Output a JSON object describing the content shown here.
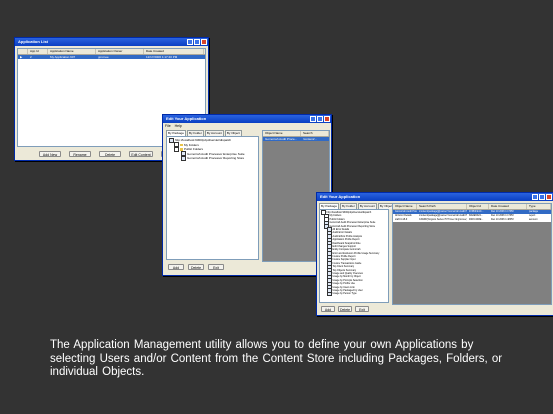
{
  "windows": {
    "app_list": {
      "title": "Application List",
      "columns": [
        "App Id",
        "Application Name",
        "Application Owner",
        "Date Created"
      ],
      "rows": [
        [
          "2",
          "My Application 907",
          "gmcnee",
          "12/17/2006 1:17:40 PM"
        ]
      ],
      "buttons": [
        "Add New",
        "Rename",
        "Delete",
        "Edit Content",
        "Close"
      ]
    },
    "edit_app_1": {
      "title": "Edit Your Application",
      "menu": [
        "File",
        "Help"
      ],
      "tabs": [
        "By Package",
        "By Folder",
        "By Account",
        "By Object"
      ],
      "tree": [
        {
          "label": "http://localhost:9300/p2pd/servlet/dispatch",
          "level": 0,
          "type": "check"
        },
        {
          "label": "My Folders",
          "level": 1,
          "type": "folder"
        },
        {
          "label": "Public Folders",
          "level": 1,
          "type": "folder"
        },
        {
          "label": "Gomorrah Audit Processor Enterprise Suite",
          "level": 2,
          "type": "check"
        },
        {
          "label": "Gomorrah Audit Processor Reporting Store",
          "level": 2,
          "type": "check"
        }
      ],
      "right_columns": [
        "Object Name",
        "Search"
      ],
      "right_rows": [
        [
          "Gomorrah Audit Proce...",
          "/content/..."
        ]
      ],
      "buttons": [
        "Add",
        "Delete",
        "Exit"
      ]
    },
    "edit_app_2": {
      "title": "Edit Your Application",
      "tabs": [
        "By Package",
        "By Folder",
        "By Account",
        "By Object"
      ],
      "tree": [
        "http://localhost:9300/p2pd/servlet/dispatch",
        "My Folders",
        "Public Folders",
        "Gomorrah Audit Processor Enterprise Suite",
        "Gomorrah Audit Processor Reporting Store",
        "All Error Details",
        "Audit Error Details",
        "Audit Ethics Profile Analysis",
        "Application Profile Report",
        "Dashboard Snapshot Rule",
        "Edit Changes Support",
        "Entity Compare Gomorrah",
        "Error and Exclusion Profile Usage Summary",
        "Invoice Profile Report",
        "Invoice Supplier Input",
        "Invoice Transactions Guide",
        "Top Client Summary",
        "Top Objects Summary",
        "Usage and Quality Overview",
        "Usage by Month by Object",
        "Usage by Prompts Selection",
        "Usage by Profile Use",
        "Usage by Users Link",
        "Usage by Packaged by User",
        "Usage by Person Type"
      ],
      "right_columns": [
        "Object Name",
        "Search Path",
        "Object Id",
        "Date Created",
        "Type"
      ],
      "right_rows": [
        [
          "Gomorrah Audit Proc...",
          "/content/package[@name='Gomorrah Audit Proc...",
          "iC3B4FE1C...",
          "Dec 10 2006 1:17PM",
          "package"
        ],
        [
          "All Error Details",
          "/content/package[@name='Gomorrah Audit Proc...",
          "i9A0E6F24...",
          "Dec 10 2006 1:17PM",
          "report"
        ],
        [
          "staff-3-18-9",
          "CAMID('Cognos Series 7NT User Id:gmcnee')/...",
          "i64FC4D3E...",
          "Dec 10 2006 1:48PM",
          "account"
        ]
      ],
      "buttons": [
        "Add",
        "Delete",
        "Exit"
      ]
    }
  },
  "caption": "The Application Management utility allows you to define your own Applications by selecting Users and/or Content from the Content Store including Packages, Folders, or individual Objects."
}
